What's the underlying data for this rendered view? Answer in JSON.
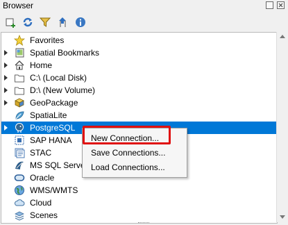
{
  "window": {
    "title": "Browser"
  },
  "tree": {
    "items": [
      {
        "label": "Favorites",
        "icon": "star-icon",
        "expandable": false
      },
      {
        "label": "Spatial Bookmarks",
        "icon": "bookmark-icon",
        "expandable": true
      },
      {
        "label": "Home",
        "icon": "home-icon",
        "expandable": true
      },
      {
        "label": "C:\\ (Local Disk)",
        "icon": "folder-icon",
        "expandable": true
      },
      {
        "label": "D:\\ (New Volume)",
        "icon": "folder-icon",
        "expandable": true
      },
      {
        "label": "GeoPackage",
        "icon": "geopackage-icon",
        "expandable": true
      },
      {
        "label": "SpatiaLite",
        "icon": "spatialite-icon",
        "expandable": false
      },
      {
        "label": "PostgreSQL",
        "icon": "postgresql-icon",
        "expandable": true,
        "selected": true
      },
      {
        "label": "SAP HANA",
        "icon": "sap-hana-icon",
        "expandable": false
      },
      {
        "label": "STAC",
        "icon": "stac-icon",
        "expandable": false
      },
      {
        "label": "MS SQL Server",
        "icon": "mssql-icon",
        "expandable": false
      },
      {
        "label": "Oracle",
        "icon": "oracle-icon",
        "expandable": false
      },
      {
        "label": "WMS/WMTS",
        "icon": "globe-icon",
        "expandable": false
      },
      {
        "label": "Cloud",
        "icon": "cloud-icon",
        "expandable": false
      },
      {
        "label": "Scenes",
        "icon": "scenes-icon",
        "expandable": false
      }
    ]
  },
  "context_menu": {
    "items": [
      {
        "label": "New Connection...",
        "highlighted": true
      },
      {
        "label": "Save Connections..."
      },
      {
        "label": "Load Connections..."
      }
    ]
  },
  "colors": {
    "selection": "#0078d7",
    "highlight_box": "#e01010"
  }
}
